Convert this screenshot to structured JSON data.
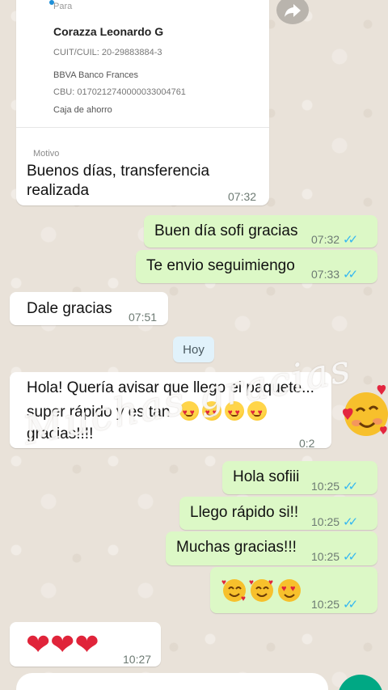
{
  "transfer": {
    "para_label": "Para",
    "name": "Corazza Leonardo G",
    "cuit": "CUIT/CUIL: 20-29883884-3",
    "bank": "BBVA Banco Frances",
    "cbu": "CBU: 0170212740000033004761",
    "account_type": "Caja de ahorro",
    "motivo_label": "Motivo",
    "message_line1": "Buenos días, transferencia",
    "message_line2": "realizada",
    "time": "07:32"
  },
  "messages": [
    {
      "text": "Buen día sofi gracias",
      "time": "07:32",
      "ticks": "✓✓"
    },
    {
      "text": "Te envio seguimiengo",
      "time": "07:33",
      "ticks": "✓✓"
    },
    {
      "text": "Dale gracias",
      "time": "07:51"
    },
    {
      "text": "Hola sofiii",
      "time": "10:25",
      "ticks": "✓✓"
    },
    {
      "text": "Llego rápido si!!",
      "time": "10:25",
      "ticks": "✓✓"
    },
    {
      "text": "Muchas gracias!!!",
      "time": "10:25",
      "ticks": "✓✓"
    },
    {
      "text": "",
      "time": "10:25",
      "ticks": "✓✓"
    },
    {
      "text": "",
      "time": "10:27"
    }
  ],
  "date_chip": "Hoy",
  "long_message": {
    "line1": "Hola! Quería avisar que llego el paquete...",
    "line2": "super rápido y es tan",
    "line3": "gracias!!!!",
    "time": "0:2"
  },
  "watermark": "Muchas gracias",
  "icons": {
    "share": "share-arrow-icon",
    "heart_eyes": "heart-eyes-emoji-icon",
    "smiling_hearts": "smiling-face-with-hearts-icon",
    "heart": "red-heart-icon"
  },
  "colors": {
    "incoming": "#ffffff",
    "outgoing": "#dcf8c6",
    "read_ticks": "#34b7f1",
    "accent": "#00a884"
  }
}
